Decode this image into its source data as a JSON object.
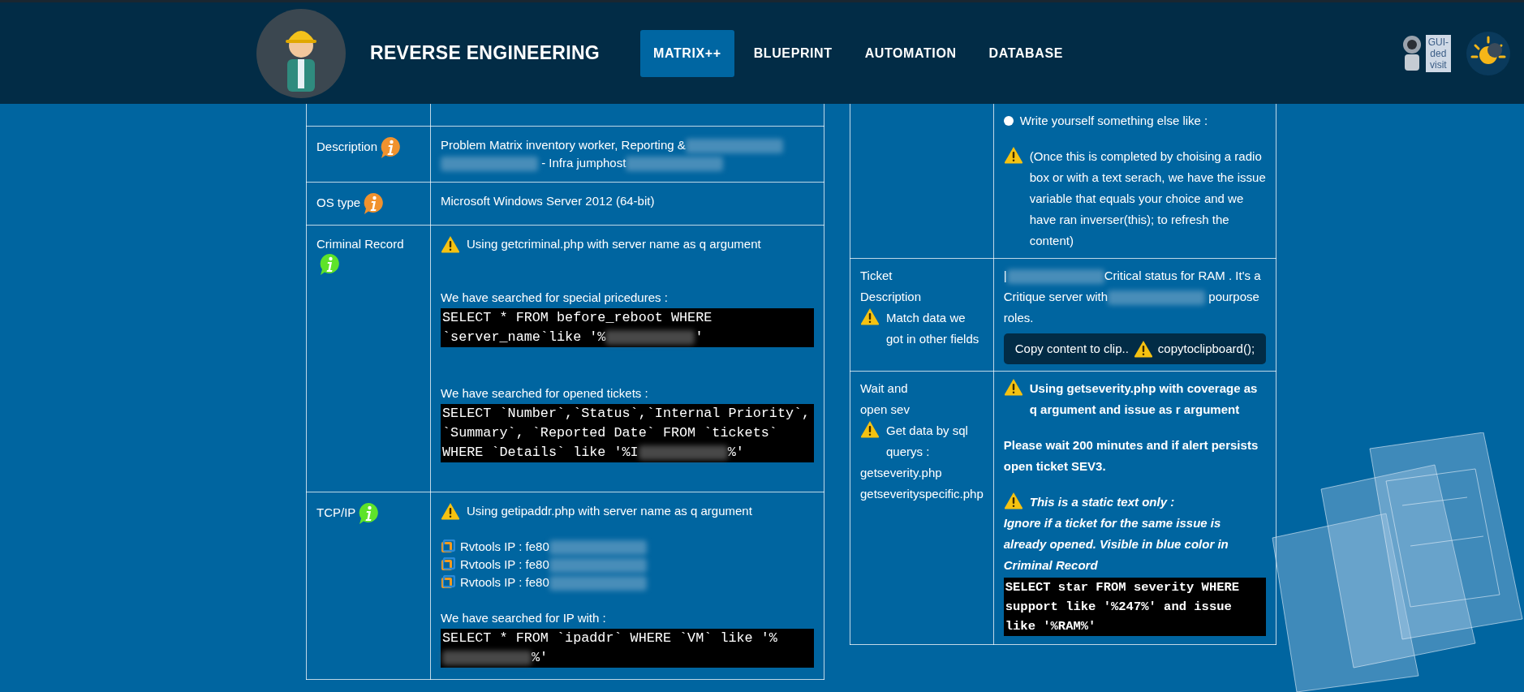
{
  "header": {
    "title": "REVERSE ENGINEERING",
    "nav": [
      {
        "label": "MATRIX++",
        "selected": true
      },
      {
        "label": "BLUEPRINT",
        "selected": false
      },
      {
        "label": "AUTOMATION",
        "selected": false
      },
      {
        "label": "DATABASE",
        "selected": false
      }
    ],
    "guided_visit": [
      "GUI-",
      "ded",
      "visit"
    ]
  },
  "left_table": {
    "rows": [
      {
        "label": "",
        "blocks": []
      },
      {
        "label": "Description",
        "color": "#f0922e",
        "blocks": [
          {
            "kind": "text",
            "parts": [
              {
                "kind": "text",
                "text": "Problem Matrix inventory worker, Reporting &"
              },
              {
                "kind": "blur"
              },
              {
                "kind": "blur"
              },
              {
                "kind": "text",
                "text": " - Infra jumphost"
              },
              {
                "kind": "blur"
              }
            ]
          }
        ]
      },
      {
        "label": "OS type",
        "color": "#f0922e",
        "blocks": [
          {
            "kind": "text",
            "parts": [
              {
                "kind": "text",
                "text": "Microsoft Windows Server 2012 (64-bit)"
              }
            ]
          }
        ]
      },
      {
        "label": "Criminal Record",
        "color": "#5ee32a",
        "blocks": [
          {
            "kind": "text",
            "warning": true,
            "parts": [
              {
                "kind": "text",
                "text": "Using getcriminal.php with server name as q argument"
              }
            ]
          },
          {
            "kind": "break"
          },
          {
            "kind": "break"
          },
          {
            "kind": "text",
            "parts": [
              {
                "kind": "text",
                "text": "We have searched for special pricedures :"
              }
            ]
          },
          {
            "kind": "code",
            "parts": [
              {
                "kind": "text",
                "text": "SELECT * FROM before_reboot WHERE `server_name`like '%"
              },
              {
                "kind": "blur"
              },
              {
                "kind": "text",
                "text": "'"
              }
            ]
          },
          {
            "kind": "break"
          },
          {
            "kind": "break"
          },
          {
            "kind": "text",
            "parts": [
              {
                "kind": "text",
                "text": "We have searched for opened tickets :"
              }
            ]
          },
          {
            "kind": "code",
            "parts": [
              {
                "kind": "text",
                "text": "SELECT `Number`,`Status`,`Internal Priority`, `Summary`, `Reported Date` FROM `tickets` WHERE `Details` like '%I"
              },
              {
                "kind": "blur"
              },
              {
                "kind": "text",
                "text": "%'"
              }
            ]
          },
          {
            "kind": "break"
          }
        ]
      },
      {
        "label": "TCP/IP",
        "color": "#5ee32a",
        "blocks": [
          {
            "kind": "text",
            "warning": true,
            "parts": [
              {
                "kind": "text",
                "text": "Using getipaddr.php with server name as q argument"
              }
            ]
          },
          {
            "kind": "break"
          },
          {
            "kind": "ip",
            "parts": [
              {
                "kind": "text",
                "text": "Rvtools IP : fe80"
              },
              {
                "kind": "blur"
              }
            ]
          },
          {
            "kind": "ip",
            "parts": [
              {
                "kind": "text",
                "text": "Rvtools IP : fe80"
              },
              {
                "kind": "blur"
              }
            ]
          },
          {
            "kind": "ip",
            "parts": [
              {
                "kind": "text",
                "text": "Rvtools IP : fe80"
              },
              {
                "kind": "blur"
              }
            ]
          },
          {
            "kind": "break"
          },
          {
            "kind": "text",
            "parts": [
              {
                "kind": "text",
                "text": "We have searched for IP with :"
              }
            ]
          },
          {
            "kind": "code",
            "parts": [
              {
                "kind": "text",
                "text": "SELECT * FROM `ipaddr` WHERE `VM` like '%"
              },
              {
                "kind": "blur"
              },
              {
                "kind": "text",
                "text": "%'"
              }
            ]
          }
        ]
      }
    ]
  },
  "right_table": {
    "rows": [
      {
        "label_blocks": [],
        "blocks": [
          {
            "kind": "radio",
            "text": "Write yourself something else like :",
            "selected": false
          },
          {
            "kind": "break"
          },
          {
            "kind": "text",
            "warning": true,
            "parts": [
              {
                "kind": "text",
                "text": "(Once this is completed by choising a radio box or with a text serach, we have the issue variable that equals your choice and we have ran inverser(this); to refresh the content)"
              }
            ]
          }
        ]
      },
      {
        "label_blocks": [
          {
            "kind": "text",
            "parts": [
              {
                "kind": "text",
                "text": "Ticket"
              }
            ]
          },
          {
            "kind": "text",
            "parts": [
              {
                "kind": "text",
                "text": "Description"
              }
            ]
          },
          {
            "kind": "text",
            "warning": true,
            "parts": [
              {
                "kind": "text",
                "text": "Match data we got in other fields"
              }
            ]
          }
        ],
        "blocks": [
          {
            "kind": "text",
            "parts": [
              {
                "kind": "text",
                "text": "|"
              },
              {
                "kind": "blur"
              },
              {
                "kind": "text",
                "text": "Critical status for RAM . It's a Critique server with"
              },
              {
                "kind": "blur"
              },
              {
                "kind": "text",
                "text": " pourpose roles."
              }
            ]
          },
          {
            "kind": "copy",
            "label": "Copy content to clip..",
            "code": "copytoclipboard();"
          }
        ]
      },
      {
        "label_blocks": [
          {
            "kind": "text",
            "parts": [
              {
                "kind": "text",
                "text": "Wait and"
              }
            ]
          },
          {
            "kind": "text",
            "parts": [
              {
                "kind": "text",
                "text": "open sev"
              }
            ]
          },
          {
            "kind": "text",
            "warning": true,
            "parts": [
              {
                "kind": "text",
                "text": "Get data by sql querys :"
              }
            ]
          },
          {
            "kind": "text",
            "parts": [
              {
                "kind": "text",
                "text": "getseverity.php"
              }
            ]
          },
          {
            "kind": "text",
            "parts": [
              {
                "kind": "text",
                "text": "getseverityspecific.php"
              }
            ]
          }
        ],
        "blocks": [
          {
            "kind": "text",
            "warning": true,
            "bold": true,
            "parts": [
              {
                "kind": "text",
                "text": "Using getseverity.php with coverage as q argument and issue as r argument"
              }
            ]
          },
          {
            "kind": "break"
          },
          {
            "kind": "text",
            "bold": true,
            "parts": [
              {
                "kind": "text",
                "text": "Please wait 200 minutes and if alert persists"
              }
            ]
          },
          {
            "kind": "text",
            "bold": true,
            "parts": [
              {
                "kind": "text",
                "text": "open ticket SEV3."
              }
            ]
          },
          {
            "kind": "break"
          },
          {
            "kind": "text",
            "warning": true,
            "bold": true,
            "italic": true,
            "parts": [
              {
                "kind": "text",
                "text": "This is a static text only :"
              }
            ]
          },
          {
            "kind": "text",
            "bold": true,
            "italic": true,
            "parts": [
              {
                "kind": "text",
                "text": "Ignore if a ticket for the same issue is already opened. Visible in blue color in Criminal Record"
              }
            ]
          },
          {
            "kind": "code",
            "bold": true,
            "parts": [
              {
                "kind": "text",
                "text": "SELECT star FROM severity WHERE support like '%247%' and issue like '%RAM%'"
              }
            ]
          }
        ]
      }
    ]
  }
}
